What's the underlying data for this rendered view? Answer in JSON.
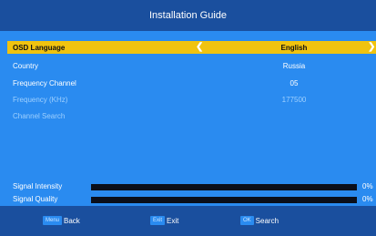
{
  "header": {
    "title": "Installation Guide"
  },
  "menu": {
    "rows": [
      {
        "label": "OSD Language",
        "value": "English"
      },
      {
        "label": "Country",
        "value": "Russia"
      },
      {
        "label": "Frequency Channel",
        "value": "05"
      },
      {
        "label": "Frequency (KHz)",
        "value": "177500"
      },
      {
        "label": "Channel Search",
        "value": ""
      }
    ],
    "arrow_left": "❮",
    "arrow_right": "❯"
  },
  "signals": [
    {
      "label": "Signal Intensity",
      "percent_text": "0%",
      "level": 0
    },
    {
      "label": "Signal Quality",
      "percent_text": "0%",
      "level": 0
    }
  ],
  "footer": {
    "back": {
      "key": "Menu",
      "label": "Back"
    },
    "exit": {
      "key": "Exit",
      "label": "Exit"
    },
    "search": {
      "key": "OK",
      "label": "Search"
    }
  },
  "colors": {
    "title_bar": "#1a4f9e",
    "content_bg": "#2a8bf0",
    "selected_row": "#f0c30f",
    "signal_bar": "#0b0f1a"
  }
}
